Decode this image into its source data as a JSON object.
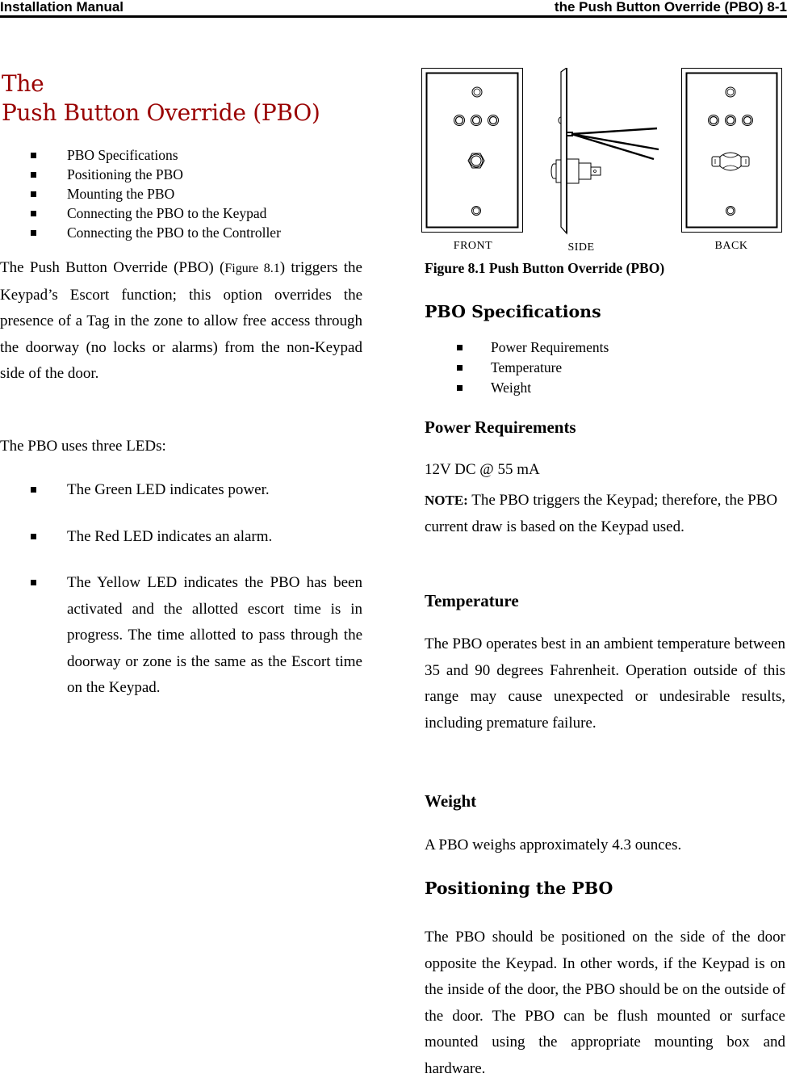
{
  "header": {
    "left": "Installation Manual",
    "right": "the Push Button Override (PBO) 8-1"
  },
  "title": {
    "line1": "The",
    "line2": "Push Button Override (PBO)"
  },
  "toc": [
    "PBO Specifications",
    "Positioning the PBO",
    "Mounting the PBO",
    "Connecting the PBO to the Keypad",
    "Connecting the PBO to the Controller"
  ],
  "intro": {
    "before_ref": "The Push Button Override (PBO) (",
    "figure_ref": "Figure 8.1",
    "after_ref": ") triggers the Keypad’s Escort function; this option overrides the presence of a Tag in the zone to allow free access through the doorway (no locks or alarms) from the non-Keypad side of the door."
  },
  "leds_intro": "The PBO uses three LEDs:",
  "leds": [
    "The Green LED indicates power.",
    "The Red LED indicates an alarm.",
    "The Yellow LED indicates the PBO has been activated and the allotted escort time is in progress. The time allotted to pass through the doorway or zone is the same as the Escort time on the Keypad."
  ],
  "figure": {
    "labels": {
      "front": "FRONT",
      "side": "SIDE",
      "back": "BACK"
    },
    "caption": "Figure 8.1 Push Button Override (PBO)"
  },
  "specs": {
    "heading": "PBO Specifications",
    "items": [
      "Power Requirements",
      "Temperature",
      "Weight"
    ]
  },
  "power": {
    "heading": "Power Requirements",
    "value": "12V DC @ 55 mA",
    "note_label": "NOTE:",
    "note_text": " The PBO triggers the Keypad; therefore, the PBO current draw is based on the Keypad used."
  },
  "temperature": {
    "heading": "Temperature",
    "text": "The PBO operates best in an ambient temperature between 35 and 90 degrees Fahrenheit. Operation outside of this range may cause unexpected or undesirable results, including premature failure."
  },
  "weight": {
    "heading": "Weight",
    "text": "A PBO weighs approximately 4.3 ounces."
  },
  "positioning": {
    "heading": "Positioning the PBO",
    "text": "The PBO should be positioned on the side of the door opposite the Keypad. In other words, if the Keypad is on the inside of the door, the PBO should be on the outside of the door. The PBO can be flush mounted or surface mounted using the appropriate mounting box and hardware."
  },
  "colors": {
    "title": "#990000",
    "text": "#000000"
  }
}
